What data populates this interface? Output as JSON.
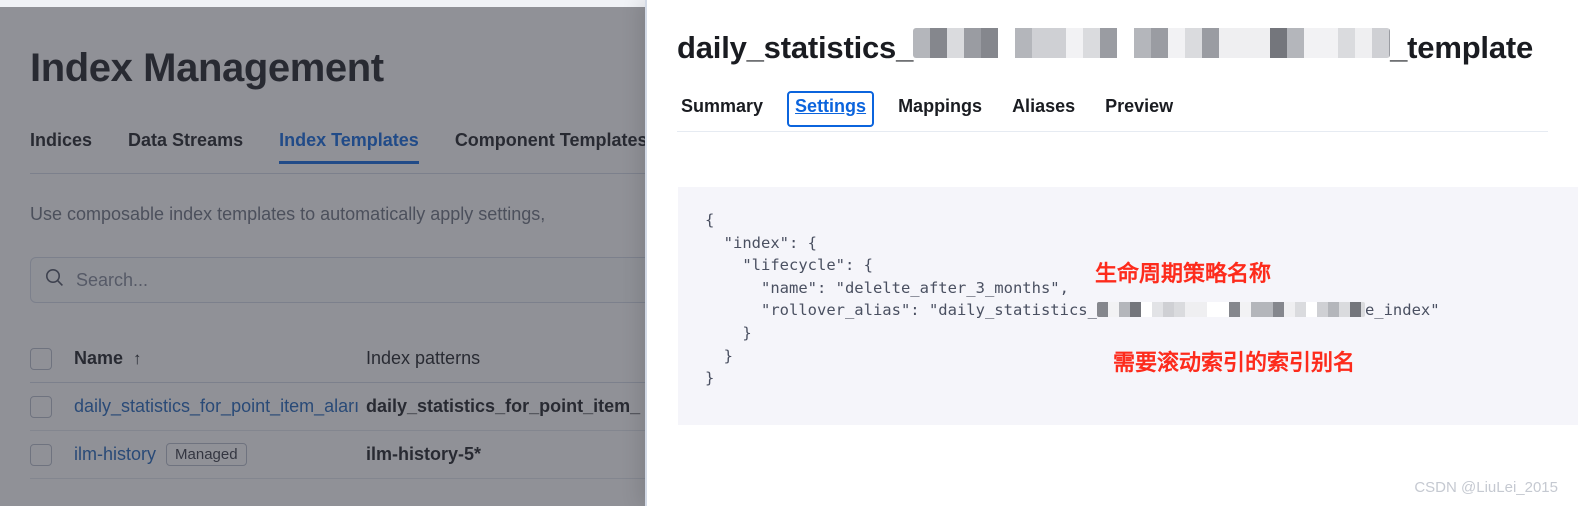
{
  "background_page": {
    "title": "Index Management",
    "tabs": [
      {
        "label": "Indices",
        "active": false
      },
      {
        "label": "Data Streams",
        "active": false
      },
      {
        "label": "Index Templates",
        "active": true
      },
      {
        "label": "Component Templates",
        "active": false
      }
    ],
    "description": "Use composable index templates to automatically apply settings,",
    "search": {
      "placeholder": "Search...",
      "value": "",
      "icon": "search-icon"
    },
    "table": {
      "columns": [
        "Name",
        "Index patterns"
      ],
      "sort_column": "Name",
      "sort_direction_icon": "arrow-up-icon",
      "rows": [
        {
          "name": "daily_statistics_for_point_item_aları",
          "badge": "",
          "index_pattern": "daily_statistics_for_point_item_",
          "checked": false
        },
        {
          "name": "ilm-history",
          "badge": "Managed",
          "index_pattern": "ilm-history-5*",
          "checked": false
        }
      ]
    }
  },
  "flyout": {
    "title_prefix": "daily_statistics_",
    "title_redacted": true,
    "title_middle_separator": "_",
    "title_suffix": "_template",
    "tabs": [
      {
        "label": "Summary",
        "state": "normal"
      },
      {
        "label": "Settings",
        "state": "focused"
      },
      {
        "label": "Mappings",
        "state": "normal"
      },
      {
        "label": "Aliases",
        "state": "normal"
      },
      {
        "label": "Preview",
        "state": "normal"
      }
    ],
    "code": {
      "language": "json",
      "lines": [
        {
          "text": "{"
        },
        {
          "text": "  \"index\": {"
        },
        {
          "text": "    \"lifecycle\": {"
        },
        {
          "text": "      \"name\": \"delelte_after_3_months\","
        },
        {
          "text": "      \"rollover_alias\": \"daily_statistics_",
          "redacted": true,
          "text_after": "e_index\""
        },
        {
          "text": "    }"
        },
        {
          "text": "  }"
        },
        {
          "text": "}"
        }
      ]
    },
    "annotations": [
      {
        "text": "生命周期策略名称",
        "color": "#fd2b1c"
      },
      {
        "text": "需要滚动索引的索引别名",
        "color": "#fd2b1c"
      }
    ]
  },
  "watermark": "CSDN @LiuLei_2015",
  "colors": {
    "accent": "#0b64dd",
    "link": "#1c62b9",
    "annotation": "#fd2b1c",
    "code_bg": "#f5f5fa",
    "overlay": "rgba(52,55,65,0.55)"
  }
}
